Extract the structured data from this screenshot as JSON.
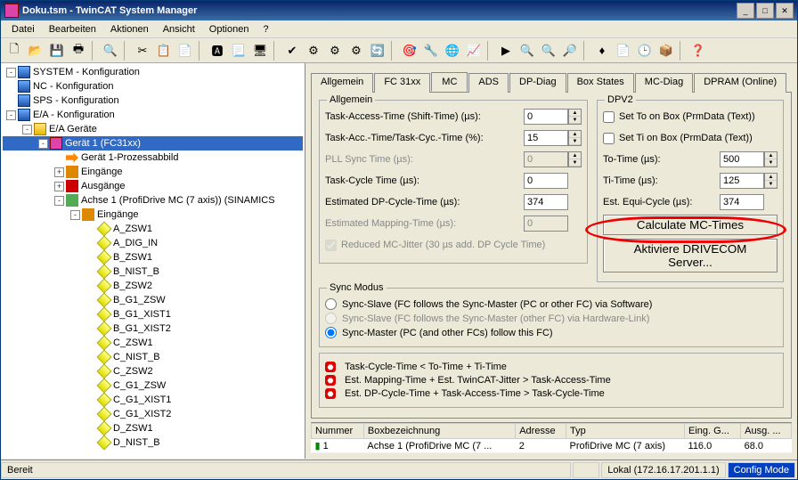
{
  "title": "Doku.tsm - TwinCAT System Manager",
  "menu": [
    "Datei",
    "Bearbeiten",
    "Aktionen",
    "Ansicht",
    "Optionen",
    "?"
  ],
  "tree": [
    {
      "d": 0,
      "t": "-",
      "ic": "ic-sys",
      "l": "SYSTEM - Konfiguration"
    },
    {
      "d": 0,
      "t": "",
      "ic": "ic-sys",
      "l": "NC - Konfiguration"
    },
    {
      "d": 0,
      "t": "",
      "ic": "ic-sys",
      "l": "SPS - Konfiguration"
    },
    {
      "d": 0,
      "t": "-",
      "ic": "ic-sys",
      "l": "E/A - Konfiguration"
    },
    {
      "d": 1,
      "t": "-",
      "ic": "ic-folder",
      "l": "E/A Geräte"
    },
    {
      "d": 2,
      "t": "-",
      "ic": "ic-dev2",
      "l": "Gerät 1 (FC31xx)",
      "sel": true
    },
    {
      "d": 3,
      "t": "",
      "ic": "ic-arrow-r",
      "l": "Gerät 1-Prozessabbild"
    },
    {
      "d": 3,
      "t": "+",
      "ic": "ic-in",
      "l": "Eingänge"
    },
    {
      "d": 3,
      "t": "+",
      "ic": "ic-out",
      "l": "Ausgänge"
    },
    {
      "d": 3,
      "t": "-",
      "ic": "ic-ax",
      "l": "Achse 1 (ProfiDrive MC (7 axis)) (SINAMICS"
    },
    {
      "d": 4,
      "t": "-",
      "ic": "ic-in",
      "l": "Eingänge"
    },
    {
      "d": 5,
      "t": "",
      "ic": "y",
      "l": "A_ZSW1"
    },
    {
      "d": 5,
      "t": "",
      "ic": "y",
      "l": "A_DIG_IN"
    },
    {
      "d": 5,
      "t": "",
      "ic": "y",
      "l": "B_ZSW1"
    },
    {
      "d": 5,
      "t": "",
      "ic": "y",
      "l": "B_NIST_B"
    },
    {
      "d": 5,
      "t": "",
      "ic": "y",
      "l": "B_ZSW2"
    },
    {
      "d": 5,
      "t": "",
      "ic": "y",
      "l": "B_G1_ZSW"
    },
    {
      "d": 5,
      "t": "",
      "ic": "y",
      "l": "B_G1_XIST1"
    },
    {
      "d": 5,
      "t": "",
      "ic": "y",
      "l": "B_G1_XIST2"
    },
    {
      "d": 5,
      "t": "",
      "ic": "y",
      "l": "C_ZSW1"
    },
    {
      "d": 5,
      "t": "",
      "ic": "y",
      "l": "C_NIST_B"
    },
    {
      "d": 5,
      "t": "",
      "ic": "y",
      "l": "C_ZSW2"
    },
    {
      "d": 5,
      "t": "",
      "ic": "y",
      "l": "C_G1_ZSW"
    },
    {
      "d": 5,
      "t": "",
      "ic": "y",
      "l": "C_G1_XIST1"
    },
    {
      "d": 5,
      "t": "",
      "ic": "y",
      "l": "C_G1_XIST2"
    },
    {
      "d": 5,
      "t": "",
      "ic": "y",
      "l": "D_ZSW1"
    },
    {
      "d": 5,
      "t": "",
      "ic": "y",
      "l": "D_NIST_B"
    }
  ],
  "tabs": [
    "Allgemein",
    "FC 31xx",
    "MC",
    "ADS",
    "DP-Diag",
    "Box States",
    "MC-Diag",
    "DPRAM (Online)"
  ],
  "active_tab": 2,
  "allgemein": {
    "title": "Allgemein",
    "task_access": {
      "l": "Task-Access-Time (Shift-Time) (µs):",
      "v": "0"
    },
    "task_acc_cyc": {
      "l": "Task-Acc.-Time/Task-Cyc.-Time (%):",
      "v": "15"
    },
    "pll_sync": {
      "l": "PLL Sync Time (µs):",
      "v": "0"
    },
    "task_cycle": {
      "l": "Task-Cycle Time (µs):",
      "v": "0"
    },
    "est_dp": {
      "l": "Estimated DP-Cycle-Time (µs):",
      "v": "374"
    },
    "est_map": {
      "l": "Estimated Mapping-Time (µs):",
      "v": "0"
    },
    "reduced": {
      "l": "Reduced MC-Jitter (30 µs add. DP Cycle Time)"
    }
  },
  "dpv2": {
    "title": "DPV2",
    "set_to": "Set To on Box (PrmData (Text))",
    "set_ti": "Set Ti on Box (PrmData (Text))",
    "to_time": {
      "l": "To-Time (µs):",
      "v": "500"
    },
    "ti_time": {
      "l": "Ti-Time (µs):",
      "v": "125"
    },
    "est_equi": {
      "l": "Est. Equi-Cycle (µs):",
      "v": "374"
    },
    "calc_btn": "Calculate MC-Times",
    "activate_btn": "Aktiviere DRIVECOM Server..."
  },
  "sync": {
    "title": "Sync Modus",
    "r1": "Sync-Slave (FC follows the Sync-Master (PC or other FC) via Software)",
    "r2": "Sync-Slave (FC follows the Sync-Master (other FC) via Hardware-Link)",
    "r3": "Sync-Master (PC (and other FCs) follow this FC)"
  },
  "warn": [
    "Task-Cycle-Time < To-Time + Ti-Time",
    "Est. Mapping-Time + Est. TwinCAT-Jitter > Task-Access-Time",
    "Est. DP-Cycle-Time + Task-Access-Time > Task-Cycle-Time"
  ],
  "grid": {
    "headers": [
      "Nummer",
      "Boxbezeichnung",
      "Adresse",
      "Typ",
      "Eing. G...",
      "Ausg. ..."
    ],
    "row": {
      "num": "1",
      "box": "Achse 1 (ProfiDrive MC (7 ...",
      "addr": "2",
      "typ": "ProfiDrive MC (7 axis)",
      "in": "116.0",
      "out": "68.0"
    }
  },
  "status": {
    "ready": "Bereit",
    "local": "Lokal (172.16.17.201.1.1)",
    "mode": "Config Mode"
  }
}
